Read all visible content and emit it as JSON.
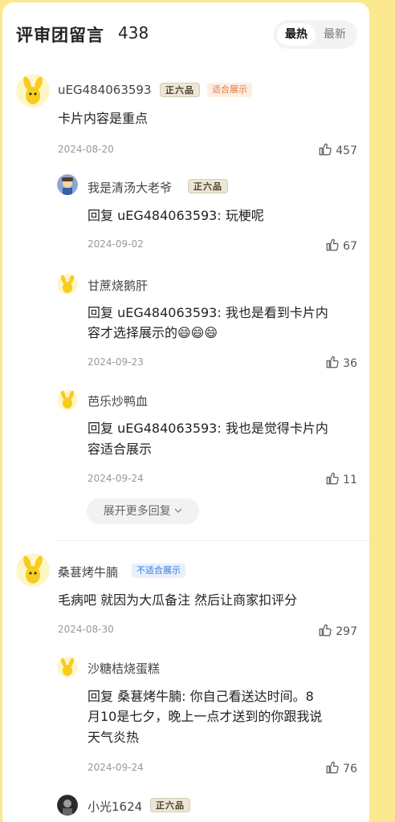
{
  "header": {
    "title": "评审团留言",
    "count": "438",
    "sort_hot": "最热",
    "sort_new": "最新"
  },
  "comments": [
    {
      "user": "uEG484063593",
      "rank": "正六品",
      "tag": "适合展示",
      "text": "卡片内容是重点",
      "date": "2024-08-20",
      "likes": "457",
      "replies": [
        {
          "user": "我是清汤大老爷",
          "rank": "正六品",
          "prefix": "回复 uEG484063593:",
          "text": " 玩梗呢",
          "date": "2024-09-02",
          "likes": "67"
        },
        {
          "user": "甘蔗烧鹅肝",
          "prefix": "回复 uEG484063593:",
          "text": " 我也是看到卡片内",
          "text2": "容才选择展示的😄😄😄",
          "date": "2024-09-23",
          "likes": "36"
        },
        {
          "user": "芭乐炒鸭血",
          "prefix": "回复 uEG484063593:",
          "text": " 我也是觉得卡片内",
          "text2": "容适合展示",
          "date": "2024-09-24",
          "likes": "11"
        }
      ],
      "more_replies": "展开更多回复"
    },
    {
      "user": "桑葚烤牛腩",
      "tag": "不适合展示",
      "text": "毛病吧 就因为大瓜备注 然后让商家扣评分",
      "date": "2024-08-30",
      "likes": "297",
      "replies": [
        {
          "user": "沙糖桔烧蛋糕",
          "prefix": "回复 桑葚烤牛腩:",
          "text": " 你自己看送达时间。8",
          "text2": "月10是七夕，晚上一点才送到的你跟我说",
          "text3": "天气炎热",
          "date": "2024-09-24",
          "likes": "76"
        },
        {
          "user": "小光1624",
          "rank": "正六品"
        }
      ]
    }
  ],
  "icons": {
    "like": "thumbs-up-icon",
    "chevron": "chevron-down-icon",
    "avatar": "yellow-mascot-avatar"
  },
  "colors": {
    "page_bg": "#fbe88f",
    "panel_bg": "#ffffff",
    "tag_good": "#e07a3a",
    "tag_bad": "#3a78d8"
  }
}
